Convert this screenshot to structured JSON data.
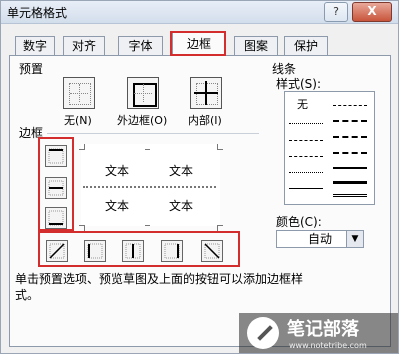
{
  "window": {
    "title": "单元格格式",
    "help_label": "?",
    "close_label": "X"
  },
  "tabs": [
    "数字",
    "对齐",
    "字体",
    "边框",
    "图案",
    "保护"
  ],
  "active_tab": "边框",
  "presets": {
    "heading": "预置",
    "items": [
      "无(N)",
      "外边框(O)",
      "内部(I)"
    ]
  },
  "border": {
    "heading": "边框",
    "preview_text": "文本"
  },
  "line": {
    "heading": "线条",
    "style_label": "样式(S):",
    "none_label": "无",
    "color_label": "颜色(C):",
    "color_value": "自动",
    "dropdown_icon": "triangle-down"
  },
  "hint": "单击预置选项、预览草图及上面的按钮可以添加边框样式。",
  "watermark": {
    "title": "笔记部落",
    "url": "www.notetribe.com"
  },
  "colors": {
    "highlight": "#d42d2d",
    "title_bar": "#d3deec"
  }
}
